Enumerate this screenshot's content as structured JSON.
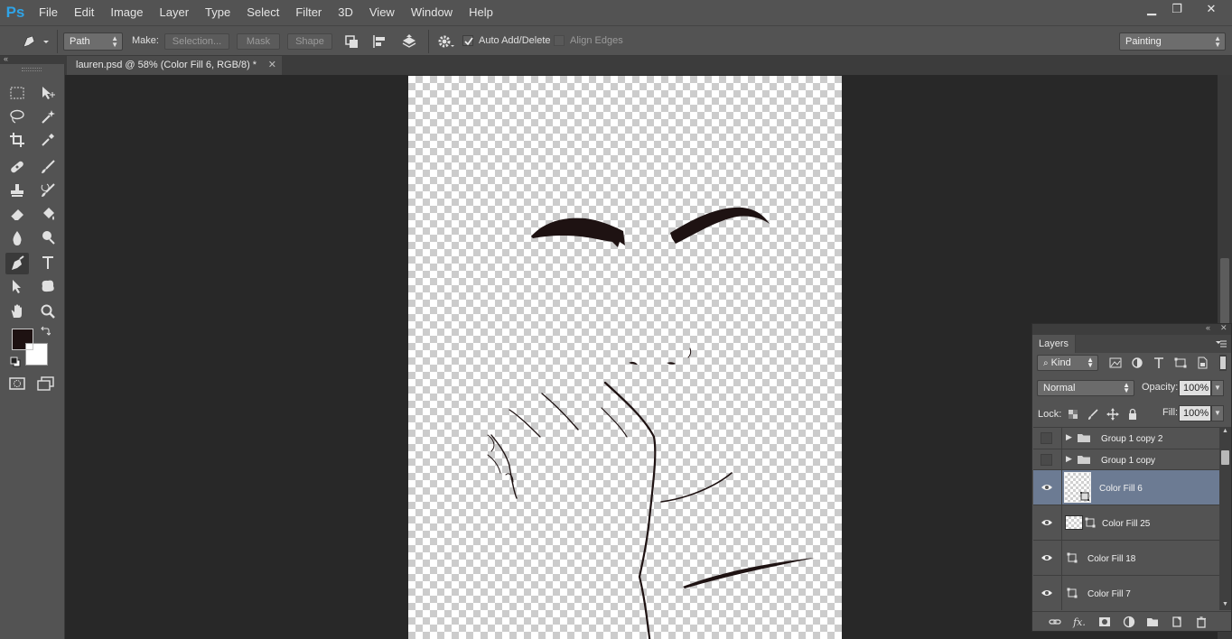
{
  "app": {
    "logo": "Ps"
  },
  "menu": [
    "File",
    "Edit",
    "Image",
    "Layer",
    "Type",
    "Select",
    "Filter",
    "3D",
    "View",
    "Window",
    "Help"
  ],
  "window_controls": {
    "minimize": "▁",
    "restore": "❐",
    "close": "✕"
  },
  "options": {
    "mode_value": "Path",
    "make_label": "Make:",
    "selection_label": "Selection...",
    "mask_label": "Mask",
    "shape_label": "Shape",
    "auto_add_delete_label": "Auto Add/Delete",
    "auto_add_delete_checked": true,
    "align_edges_label": "Align Edges",
    "align_edges_checked": false,
    "workspace_value": "Painting"
  },
  "document": {
    "tab_title": "lauren.psd @ 58% (Color Fill 6, RGB/8) *",
    "close": "✕"
  },
  "tools": {
    "foreground_color": "#1e1212",
    "background_color": "#ffffff",
    "active_tool": "pen-tool"
  },
  "layers_panel": {
    "title": "Layers",
    "filter_value": "Kind",
    "blend_mode": "Normal",
    "opacity_label": "Opacity:",
    "opacity_value": "100%",
    "lock_label": "Lock:",
    "fill_label": "Fill:",
    "fill_value": "100%",
    "layers": [
      {
        "name": "Group 1 copy 2",
        "type": "group",
        "visible": false
      },
      {
        "name": "Group 1 copy",
        "type": "group",
        "visible": false
      },
      {
        "name": "Color Fill 6",
        "type": "fill",
        "visible": true,
        "selected": true
      },
      {
        "name": "Color Fill 25",
        "type": "fill",
        "visible": true
      },
      {
        "name": "Color Fill 18",
        "type": "fill-small",
        "visible": true
      },
      {
        "name": "Color Fill 7",
        "type": "fill-small",
        "visible": true
      }
    ]
  },
  "colors": {
    "chrome": "#535353",
    "canvas_bg": "#282828",
    "selection": "#6c7b93",
    "accent_logo": "#2fa3e6",
    "ink": "#1e1212"
  }
}
